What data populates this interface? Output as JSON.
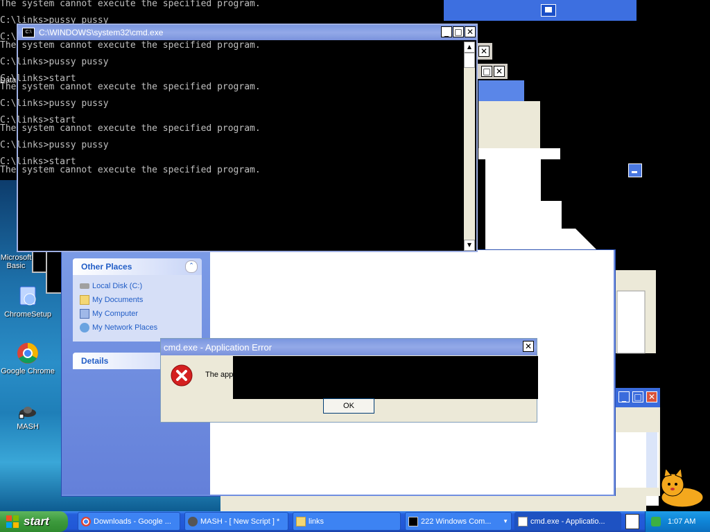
{
  "console_bg_lines": {
    "l1": "The system cannot execute the specified program.",
    "l2": "C:\\links>pussy pussy",
    "l3": "C:\\"
  },
  "cmd_window": {
    "title": "C:\\WINDOWS\\system32\\cmd.exe",
    "lines": [
      "The system cannot execute the specified program.",
      "",
      "C:\\links>pussy pussy",
      "",
      "C:\\links>start",
      "The system cannot execute the specified program.",
      "",
      "C:\\links>pussy pussy",
      "",
      "C:\\links>start",
      "The system cannot execute the specified program.",
      "",
      "C:\\links>pussy pussy",
      "",
      "C:\\links>start",
      "The system cannot execute the specified program."
    ]
  },
  "desktop_icons": {
    "data_label": "Data",
    "ms_label_1": "Microsoft",
    "ms_label_2": "Basic",
    "chrome_setup": "ChromeSetup",
    "google_chrome": "Google Chrome",
    "mash": "MASH"
  },
  "explorer": {
    "other_places_title": "Other Places",
    "links": [
      "Local Disk (C:)",
      "My Documents",
      "My Computer",
      "My Network Places"
    ],
    "details_title": "Details"
  },
  "error_dialog": {
    "title": "cmd.exe - Application Error",
    "message": "The app",
    "ok_label": "OK"
  },
  "taskbar": {
    "start_label": "start",
    "tasks": [
      {
        "label": "Downloads - Google ..."
      },
      {
        "label": "MASH - [ New Script ] *"
      },
      {
        "label": "links"
      },
      {
        "label": "222 Windows Com..."
      },
      {
        "label": "cmd.exe - Applicatio..."
      }
    ],
    "clock": "1:07 AM"
  },
  "colors": {
    "taskbar_blue": "#245edb",
    "start_green": "#3c9a3c",
    "title_inactive": "#7a96df",
    "error_red": "#d42020"
  }
}
